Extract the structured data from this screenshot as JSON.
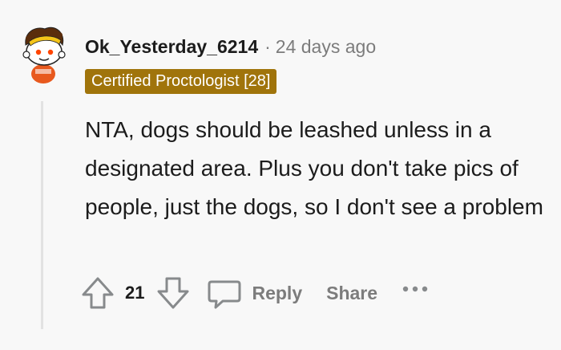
{
  "comment": {
    "author": "Ok_Yesterday_6214",
    "separator": "·",
    "timestamp": "24 days ago",
    "flair": "Certified Proctologist [28]",
    "body": "NTA, dogs should be leashed unless in a designated area. Plus you don't take pics of people, just the dogs, so I don't see a problem",
    "vote_count": "21"
  },
  "actions": {
    "reply_label": "Reply",
    "share_label": "Share",
    "more_icon": "ellipsis-icon"
  },
  "icons": {
    "upvote": "upvote-arrow-icon",
    "downvote": "downvote-arrow-icon",
    "reply": "speech-bubble-icon"
  },
  "colors": {
    "background": "#f8f8f8",
    "flair_bg": "#a0740b",
    "flair_text": "#ffffff",
    "text_primary": "#1c1c1c",
    "text_muted": "#7c7c7c"
  }
}
